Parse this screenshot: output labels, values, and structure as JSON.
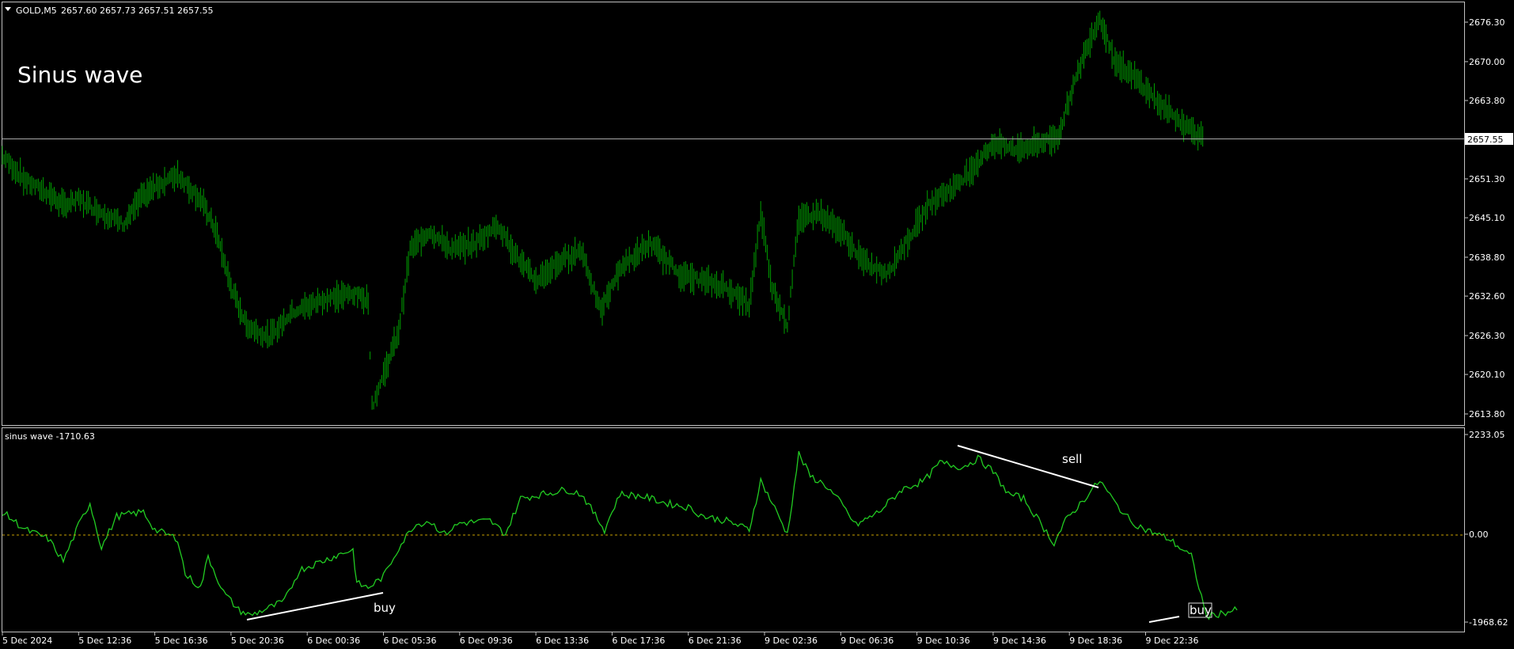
{
  "header": {
    "symbol": "GOLD,M5",
    "ohlc": "2657.60 2657.73 2657.51 2657.55"
  },
  "overlay_title": "Sinus wave",
  "price_axis": {
    "ticks": [
      "2676.30",
      "2670.00",
      "2663.80",
      "2657.55",
      "2651.30",
      "2645.10",
      "2638.80",
      "2632.60",
      "2626.30",
      "2620.10",
      "2613.80"
    ],
    "current_price": "2657.55"
  },
  "indicator": {
    "label": "sinus wave -1710.63",
    "ticks": [
      "2233.05",
      "0.00",
      "-1968.62"
    ]
  },
  "time_axis": {
    "labels": [
      "5 Dec 2024",
      "5 Dec 12:36",
      "5 Dec 16:36",
      "5 Dec 20:36",
      "6 Dec 00:36",
      "6 Dec 05:36",
      "6 Dec 09:36",
      "6 Dec 13:36",
      "6 Dec 17:36",
      "6 Dec 21:36",
      "9 Dec 02:36",
      "9 Dec 06:36",
      "9 Dec 10:36",
      "9 Dec 14:36",
      "9 Dec 18:36",
      "9 Dec 22:36"
    ]
  },
  "annotations": {
    "buy_1": "buy",
    "sell": "sell",
    "buy_2": "buy"
  },
  "colors": {
    "background": "#000000",
    "price": "#00a000",
    "indicator": "#22cc22",
    "zero_line": "#c8a000",
    "text": "#ffffff"
  },
  "chart_data": [
    {
      "type": "line",
      "title": "GOLD,M5",
      "x": [
        "5 Dec 2024",
        "5 Dec 12:36",
        "5 Dec 16:36",
        "5 Dec 20:36",
        "6 Dec 00:36",
        "6 Dec 05:36",
        "6 Dec 09:36",
        "6 Dec 13:36",
        "6 Dec 17:36",
        "6 Dec 21:36",
        "9 Dec 02:36",
        "9 Dec 06:36",
        "9 Dec 10:36",
        "9 Dec 14:36",
        "9 Dec 18:36",
        "9 Dec 22:36"
      ],
      "series": [
        {
          "name": "GOLD,M5",
          "points": [
            [
              0,
              2655
            ],
            [
              0.3,
              2651
            ],
            [
              0.6,
              2649
            ],
            [
              0.8,
              2647
            ],
            [
              1.0,
              2648
            ],
            [
              1.3,
              2646
            ],
            [
              1.6,
              2644
            ],
            [
              1.8,
              2648
            ],
            [
              2.0,
              2650
            ],
            [
              2.3,
              2652
            ],
            [
              2.6,
              2648
            ],
            [
              2.8,
              2643
            ],
            [
              3.0,
              2634
            ],
            [
              3.2,
              2628
            ],
            [
              3.5,
              2626
            ],
            [
              3.8,
              2630
            ],
            [
              4.2,
              2632
            ],
            [
              4.6,
              2633
            ],
            [
              4.8,
              2632
            ],
            [
              4.85,
              2615
            ],
            [
              5.0,
              2620
            ],
            [
              5.2,
              2627
            ],
            [
              5.35,
              2640
            ],
            [
              5.6,
              2643
            ],
            [
              5.9,
              2640
            ],
            [
              6.2,
              2641
            ],
            [
              6.5,
              2644
            ],
            [
              6.8,
              2638
            ],
            [
              7.0,
              2635
            ],
            [
              7.3,
              2638
            ],
            [
              7.6,
              2640
            ],
            [
              7.85,
              2630
            ],
            [
              8.1,
              2637
            ],
            [
              8.5,
              2641
            ],
            [
              8.9,
              2636
            ],
            [
              9.2,
              2635
            ],
            [
              9.5,
              2634
            ],
            [
              9.8,
              2631
            ],
            [
              9.95,
              2646
            ],
            [
              10.1,
              2634
            ],
            [
              10.3,
              2628
            ],
            [
              10.45,
              2645
            ],
            [
              10.7,
              2646
            ],
            [
              11.0,
              2643
            ],
            [
              11.3,
              2638
            ],
            [
              11.6,
              2636
            ],
            [
              11.9,
              2642
            ],
            [
              12.2,
              2648
            ],
            [
              12.5,
              2650
            ],
            [
              12.8,
              2654
            ],
            [
              13.0,
              2657
            ],
            [
              13.3,
              2656
            ],
            [
              13.6,
              2657
            ],
            [
              13.85,
              2658
            ],
            [
              14.05,
              2666
            ],
            [
              14.25,
              2673
            ],
            [
              14.4,
              2677
            ],
            [
              14.6,
              2670
            ],
            [
              14.9,
              2667
            ],
            [
              15.2,
              2663
            ],
            [
              15.5,
              2660
            ],
            [
              15.75,
              2658
            ]
          ]
        }
      ],
      "ylim": [
        2611.5,
        2678.0
      ]
    },
    {
      "type": "line",
      "title": "sinus wave -1710.63",
      "x": [
        "5 Dec 2024",
        "5 Dec 12:36",
        "5 Dec 16:36",
        "5 Dec 20:36",
        "6 Dec 00:36",
        "6 Dec 05:36",
        "6 Dec 09:36",
        "6 Dec 13:36",
        "6 Dec 17:36",
        "6 Dec 21:36",
        "9 Dec 02:36",
        "9 Dec 06:36",
        "9 Dec 10:36",
        "9 Dec 14:36",
        "9 Dec 18:36",
        "9 Dec 22:36"
      ],
      "series": [
        {
          "name": "sinus wave",
          "points": [
            [
              0,
              500
            ],
            [
              0.3,
              100
            ],
            [
              0.6,
              -100
            ],
            [
              0.8,
              -600
            ],
            [
              1.0,
              200
            ],
            [
              1.15,
              700
            ],
            [
              1.3,
              -300
            ],
            [
              1.5,
              400
            ],
            [
              1.85,
              500
            ],
            [
              2.0,
              100
            ],
            [
              2.3,
              -100
            ],
            [
              2.4,
              -900
            ],
            [
              2.6,
              -1200
            ],
            [
              2.7,
              -500
            ],
            [
              2.9,
              -1300
            ],
            [
              3.1,
              -1700
            ],
            [
              3.25,
              -1820
            ],
            [
              3.5,
              -1650
            ],
            [
              3.7,
              -1500
            ],
            [
              3.9,
              -800
            ],
            [
              4.2,
              -600
            ],
            [
              4.5,
              -400
            ],
            [
              4.6,
              -350
            ],
            [
              4.65,
              -1100
            ],
            [
              4.8,
              -1200
            ],
            [
              5.0,
              -950
            ],
            [
              5.2,
              -300
            ],
            [
              5.4,
              200
            ],
            [
              5.6,
              300
            ],
            [
              5.8,
              0
            ],
            [
              6.0,
              250
            ],
            [
              6.4,
              300
            ],
            [
              6.6,
              0
            ],
            [
              6.8,
              800
            ],
            [
              7.1,
              900
            ],
            [
              7.4,
              1000
            ],
            [
              7.6,
              900
            ],
            [
              7.9,
              100
            ],
            [
              8.1,
              900
            ],
            [
              8.4,
              850
            ],
            [
              8.7,
              700
            ],
            [
              9.0,
              600
            ],
            [
              9.2,
              400
            ],
            [
              9.5,
              300
            ],
            [
              9.8,
              100
            ],
            [
              9.95,
              1200
            ],
            [
              10.1,
              700
            ],
            [
              10.3,
              0
            ],
            [
              10.45,
              1800
            ],
            [
              10.6,
              1300
            ],
            [
              10.8,
              1100
            ],
            [
              11.0,
              700
            ],
            [
              11.2,
              200
            ],
            [
              11.5,
              500
            ],
            [
              11.8,
              1000
            ],
            [
              12.1,
              1200
            ],
            [
              12.3,
              1600
            ],
            [
              12.6,
              1500
            ],
            [
              12.8,
              1700
            ],
            [
              13.0,
              1400
            ],
            [
              13.2,
              900
            ],
            [
              13.4,
              800
            ],
            [
              13.6,
              300
            ],
            [
              13.8,
              -200
            ],
            [
              13.95,
              300
            ],
            [
              14.2,
              800
            ],
            [
              14.4,
              1200
            ],
            [
              14.6,
              700
            ],
            [
              14.8,
              300
            ],
            [
              15.0,
              100
            ],
            [
              15.3,
              -100
            ],
            [
              15.6,
              -500
            ],
            [
              15.8,
              -1850
            ],
            [
              16.05,
              -1750
            ],
            [
              16.2,
              -1700
            ]
          ]
        }
      ],
      "ylim": [
        -1968.62,
        2233.05
      ]
    }
  ]
}
